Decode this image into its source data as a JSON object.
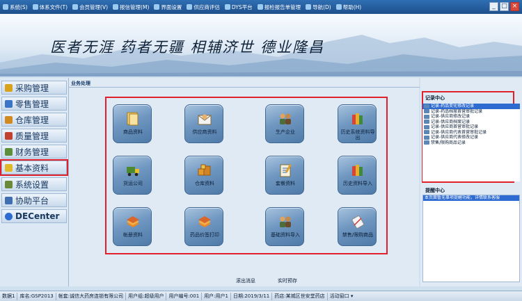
{
  "menu": {
    "items": [
      {
        "label": "系统(S)",
        "icon": "system-icon"
      },
      {
        "label": "体系文件(T)",
        "icon": "doc-icon"
      },
      {
        "label": "会员管理(V)",
        "icon": "member-icon"
      },
      {
        "label": "报信管理(M)",
        "icon": "message-icon"
      },
      {
        "label": "界面设置",
        "icon": "ui-settings-icon"
      },
      {
        "label": "供应商评估",
        "icon": "supplier-eval-icon"
      },
      {
        "label": "DYS平台",
        "icon": "platform-icon"
      },
      {
        "label": "报检报告单管理",
        "icon": "report-icon"
      },
      {
        "label": "导航(D)",
        "icon": "nav-icon"
      },
      {
        "label": "帮助(H)",
        "icon": "help-icon"
      }
    ],
    "window_buttons": {
      "minimize": "_",
      "maximize": "□",
      "close": "×"
    }
  },
  "banner": {
    "slogan": "医者无涯  药者无疆  相辅济世  德业隆昌"
  },
  "sidebar": {
    "items": [
      {
        "label": "采购管理",
        "icon": "purchase-icon",
        "color": "#d9a21b"
      },
      {
        "label": "零售管理",
        "icon": "retail-icon",
        "color": "#3a74c4"
      },
      {
        "label": "仓库管理",
        "icon": "warehouse-icon",
        "color": "#d28a1f"
      },
      {
        "label": "质量管理",
        "icon": "quality-icon",
        "color": "#c2402e"
      },
      {
        "label": "财务管理",
        "icon": "finance-icon",
        "color": "#5b8f3a"
      },
      {
        "label": "基本资料",
        "icon": "basic-data-icon",
        "color": "#e0b82a"
      },
      {
        "label": "系统设置",
        "icon": "settings-icon",
        "color": "#6a8a3a"
      },
      {
        "label": "协助平台",
        "icon": "assist-icon",
        "color": "#3f6fb2"
      },
      {
        "label": "DECenter",
        "icon": "decenter-icon",
        "color": "#2e6bd1"
      }
    ],
    "active_index": 5
  },
  "content": {
    "title": "业务处理",
    "tiles": [
      {
        "label": "商品资料",
        "icon": "goods-data-icon"
      },
      {
        "label": "供应商资料",
        "icon": "supplier-data-icon"
      },
      {
        "label": "生产企业",
        "icon": "manufacturer-icon"
      },
      {
        "label": "历史系统资料导",
        "label2": "出",
        "icon": "history-export-icon"
      },
      {
        "label": "货运公司",
        "icon": "freight-company-icon"
      },
      {
        "label": "仓库资料",
        "icon": "warehouse-data-icon"
      },
      {
        "label": "套餐资料",
        "icon": "package-data-icon"
      },
      {
        "label": "历史资料导入",
        "icon": "history-import-icon"
      },
      {
        "label": "帐册资料",
        "icon": "ledger-data-icon"
      },
      {
        "label": "药品价签打印",
        "icon": "price-tag-print-icon"
      },
      {
        "label": "基础资料导入",
        "icon": "basic-import-icon"
      },
      {
        "label": "禁售/限购商品",
        "icon": "restricted-goods-icon"
      }
    ],
    "tip_left": "滚出消息",
    "tip_right": "实时预存"
  },
  "records": {
    "title": "记录中心",
    "items": [
      "记录-药品变化修改记录",
      "记录-药品档案首营审批记录",
      "记录-供应商修改记录",
      "记录-供应商档案记录",
      "记录-供应商首营审批记录",
      "记录-供应商代表首营审批记录",
      "记录-供应商代表修改记录",
      "禁售/限购商品记录"
    ],
    "selected_index": 0
  },
  "reminders": {
    "title": "提醒中心",
    "items": [
      "本页面暂无事项提醒功能，详情联系客服"
    ]
  },
  "status": {
    "cells": [
      "数据1",
      "库名:GSP2013",
      "帐套:诚信大药房连锁有限公司",
      "用户组:超级用户",
      "用户编号:001",
      "用户:用户1",
      "日期:2019/3/11",
      "药店:某城区世安堂药店",
      "活动窗口 ▾"
    ]
  },
  "colors": {
    "highlight_frame": "#e0202a",
    "selection": "#2e6bd1",
    "menubar": "#1d4f8c"
  }
}
